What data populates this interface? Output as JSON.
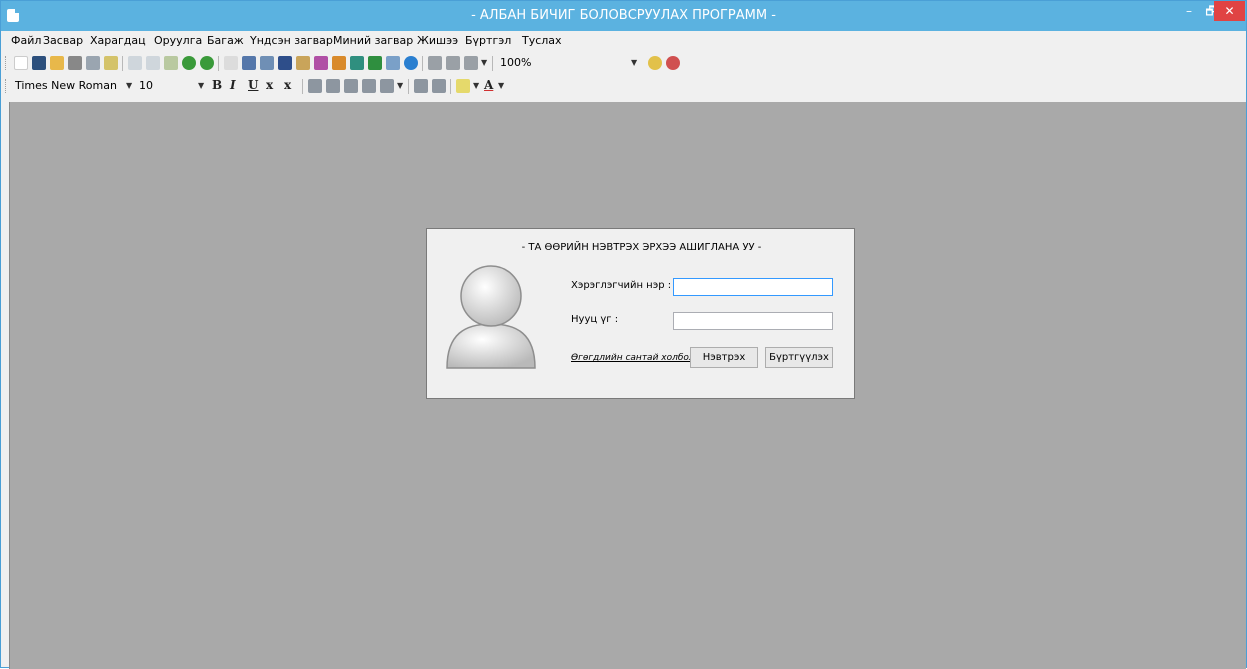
{
  "window": {
    "title": "- АЛБАН БИЧИГ БОЛОВСРУУЛАХ ПРОГРАММ -",
    "minimize": "–",
    "maximize": "🗗",
    "close": "✕",
    "accent": "#5bb2e0"
  },
  "menu": {
    "items": [
      "Файл",
      "Засвар",
      "Харагдац",
      "Оруулга",
      "Багаж",
      "Үндсэн загвар",
      "Миний загвар",
      "Жишээ",
      "Бүртгэл",
      "Туслах"
    ]
  },
  "toolbar": {
    "zoom": "100%",
    "icons": [
      "new-document-icon",
      "save-icon",
      "open-folder-icon",
      "print-icon",
      "print-preview-icon",
      "export-icon",
      "cut-icon",
      "copy-icon",
      "paste-icon",
      "undo-icon",
      "redo-icon",
      "select-pointer-icon",
      "insert-image-icon",
      "insert-textbox-icon",
      "insert-chart-icon",
      "insert-table-icon",
      "insert-shape-icon",
      "insert-clipart-icon",
      "insert-symbol-icon",
      "insert-equation-icon",
      "insert-header-icon",
      "insert-comment-icon",
      "align-left-icon",
      "align-center-icon",
      "list-icon",
      "zoom-in-icon",
      "zoom-out-icon"
    ]
  },
  "format_bar": {
    "font_family": "Times New Roman",
    "font_size": "10",
    "bold": "B",
    "italic": "I",
    "underline": "U",
    "subscript": "x",
    "superscript": "x",
    "font_color": "A"
  },
  "login": {
    "title": "- ТА ӨӨРИЙН НЭВТРЭХ ЭРХЭЭ АШИГЛАНА УУ -",
    "username_label": "Хэрэглэгчийн нэр :",
    "username_value": "",
    "password_label": "Нууц үг :",
    "password_value": "",
    "db_link": "Өгөгдлийн сантай холбох",
    "login_button": "Нэвтрэх",
    "register_button": "Бүртгүүлэх"
  }
}
